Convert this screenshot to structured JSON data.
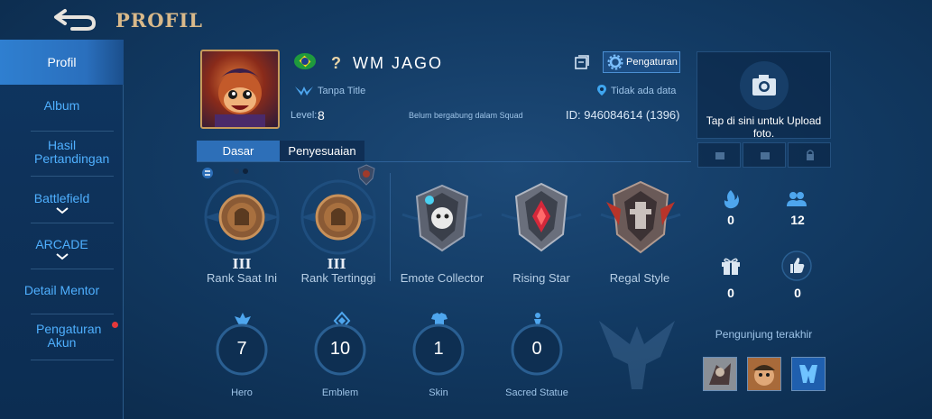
{
  "header": {
    "title": "PROFIL",
    "back_icon": "back-arrow-icon"
  },
  "sidebar": {
    "items": [
      {
        "label": "Profil",
        "active": true
      },
      {
        "label": "Album"
      },
      {
        "label": "Hasil Pertandingan"
      },
      {
        "label": "Battlefield",
        "has_dropdown": true
      },
      {
        "label": "ARCADE",
        "has_dropdown": true
      },
      {
        "label": "Detail Mentor"
      },
      {
        "label": "Pengaturan Akun",
        "has_notification": true
      }
    ]
  },
  "profile": {
    "rank_symbol": "?",
    "name": "WM JAGO",
    "title": "Tanpa Title",
    "level_label": "Level:",
    "level": "8",
    "squad": "Belum bergabung dalam Squad",
    "location": "Tidak ada data",
    "id": "ID: 946084614 (1396)",
    "settings_label": "Pengaturan"
  },
  "tabs": [
    {
      "label": "Dasar",
      "active": true
    },
    {
      "label": "Penyesuaian"
    }
  ],
  "badges": [
    {
      "label": "Rank Saat Ini",
      "tier": "III"
    },
    {
      "label": "Rank Tertinggi",
      "tier": "III"
    },
    {
      "label": "Emote Collector"
    },
    {
      "label": "Rising Star"
    },
    {
      "label": "Regal Style"
    }
  ],
  "stats": [
    {
      "label": "Hero",
      "value": "7"
    },
    {
      "label": "Emblem",
      "value": "10"
    },
    {
      "label": "Skin",
      "value": "1"
    },
    {
      "label": "Sacred Statue",
      "value": "0"
    }
  ],
  "right_panel": {
    "upload_text": "Tap di sini untuk Upload foto.",
    "stats": [
      {
        "icon": "fire-icon",
        "value": "0"
      },
      {
        "icon": "friends-icon",
        "value": "12"
      },
      {
        "icon": "gift-icon",
        "value": "0"
      },
      {
        "icon": "thumbs-up-icon",
        "value": "0"
      }
    ],
    "visitors_label": "Pengunjung terakhir"
  },
  "colors": {
    "accent": "#2d6fb8",
    "gold": "#d9b98a",
    "link": "#4fb0ff"
  }
}
